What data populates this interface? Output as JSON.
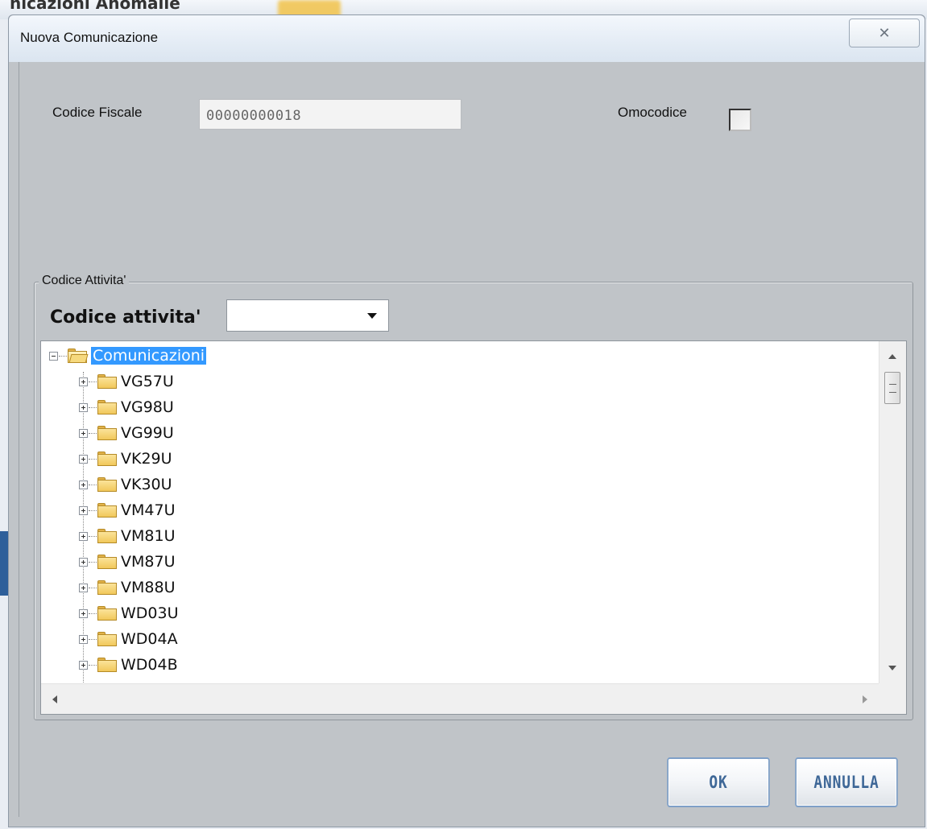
{
  "background": {
    "partial_title": "nicazioni Anomalie"
  },
  "dialog": {
    "title": "Nuova Comunicazione",
    "close_glyph": "✕"
  },
  "form": {
    "codice_fiscale_label": "Codice Fiscale",
    "codice_fiscale_value": "00000000018",
    "omocodice_label": "Omocodice",
    "omocodice_checked": false
  },
  "group": {
    "legend": "Codice Attivita'",
    "select_label": "Codice attivita'",
    "select_value": ""
  },
  "tree": {
    "root": {
      "label": "Comunicazioni",
      "expanded": true,
      "selected": true
    },
    "children": [
      "VG57U",
      "VG98U",
      "VG99U",
      "VK29U",
      "VK30U",
      "VM47U",
      "VM81U",
      "VM87U",
      "VM88U",
      "WD03U",
      "WD04A",
      "WD04B"
    ]
  },
  "buttons": {
    "ok": "OK",
    "cancel": "ANNULLA"
  },
  "colors": {
    "selection": "#3399ff",
    "dialog_bg": "#c0c4c8",
    "button_text": "#3e6797"
  }
}
